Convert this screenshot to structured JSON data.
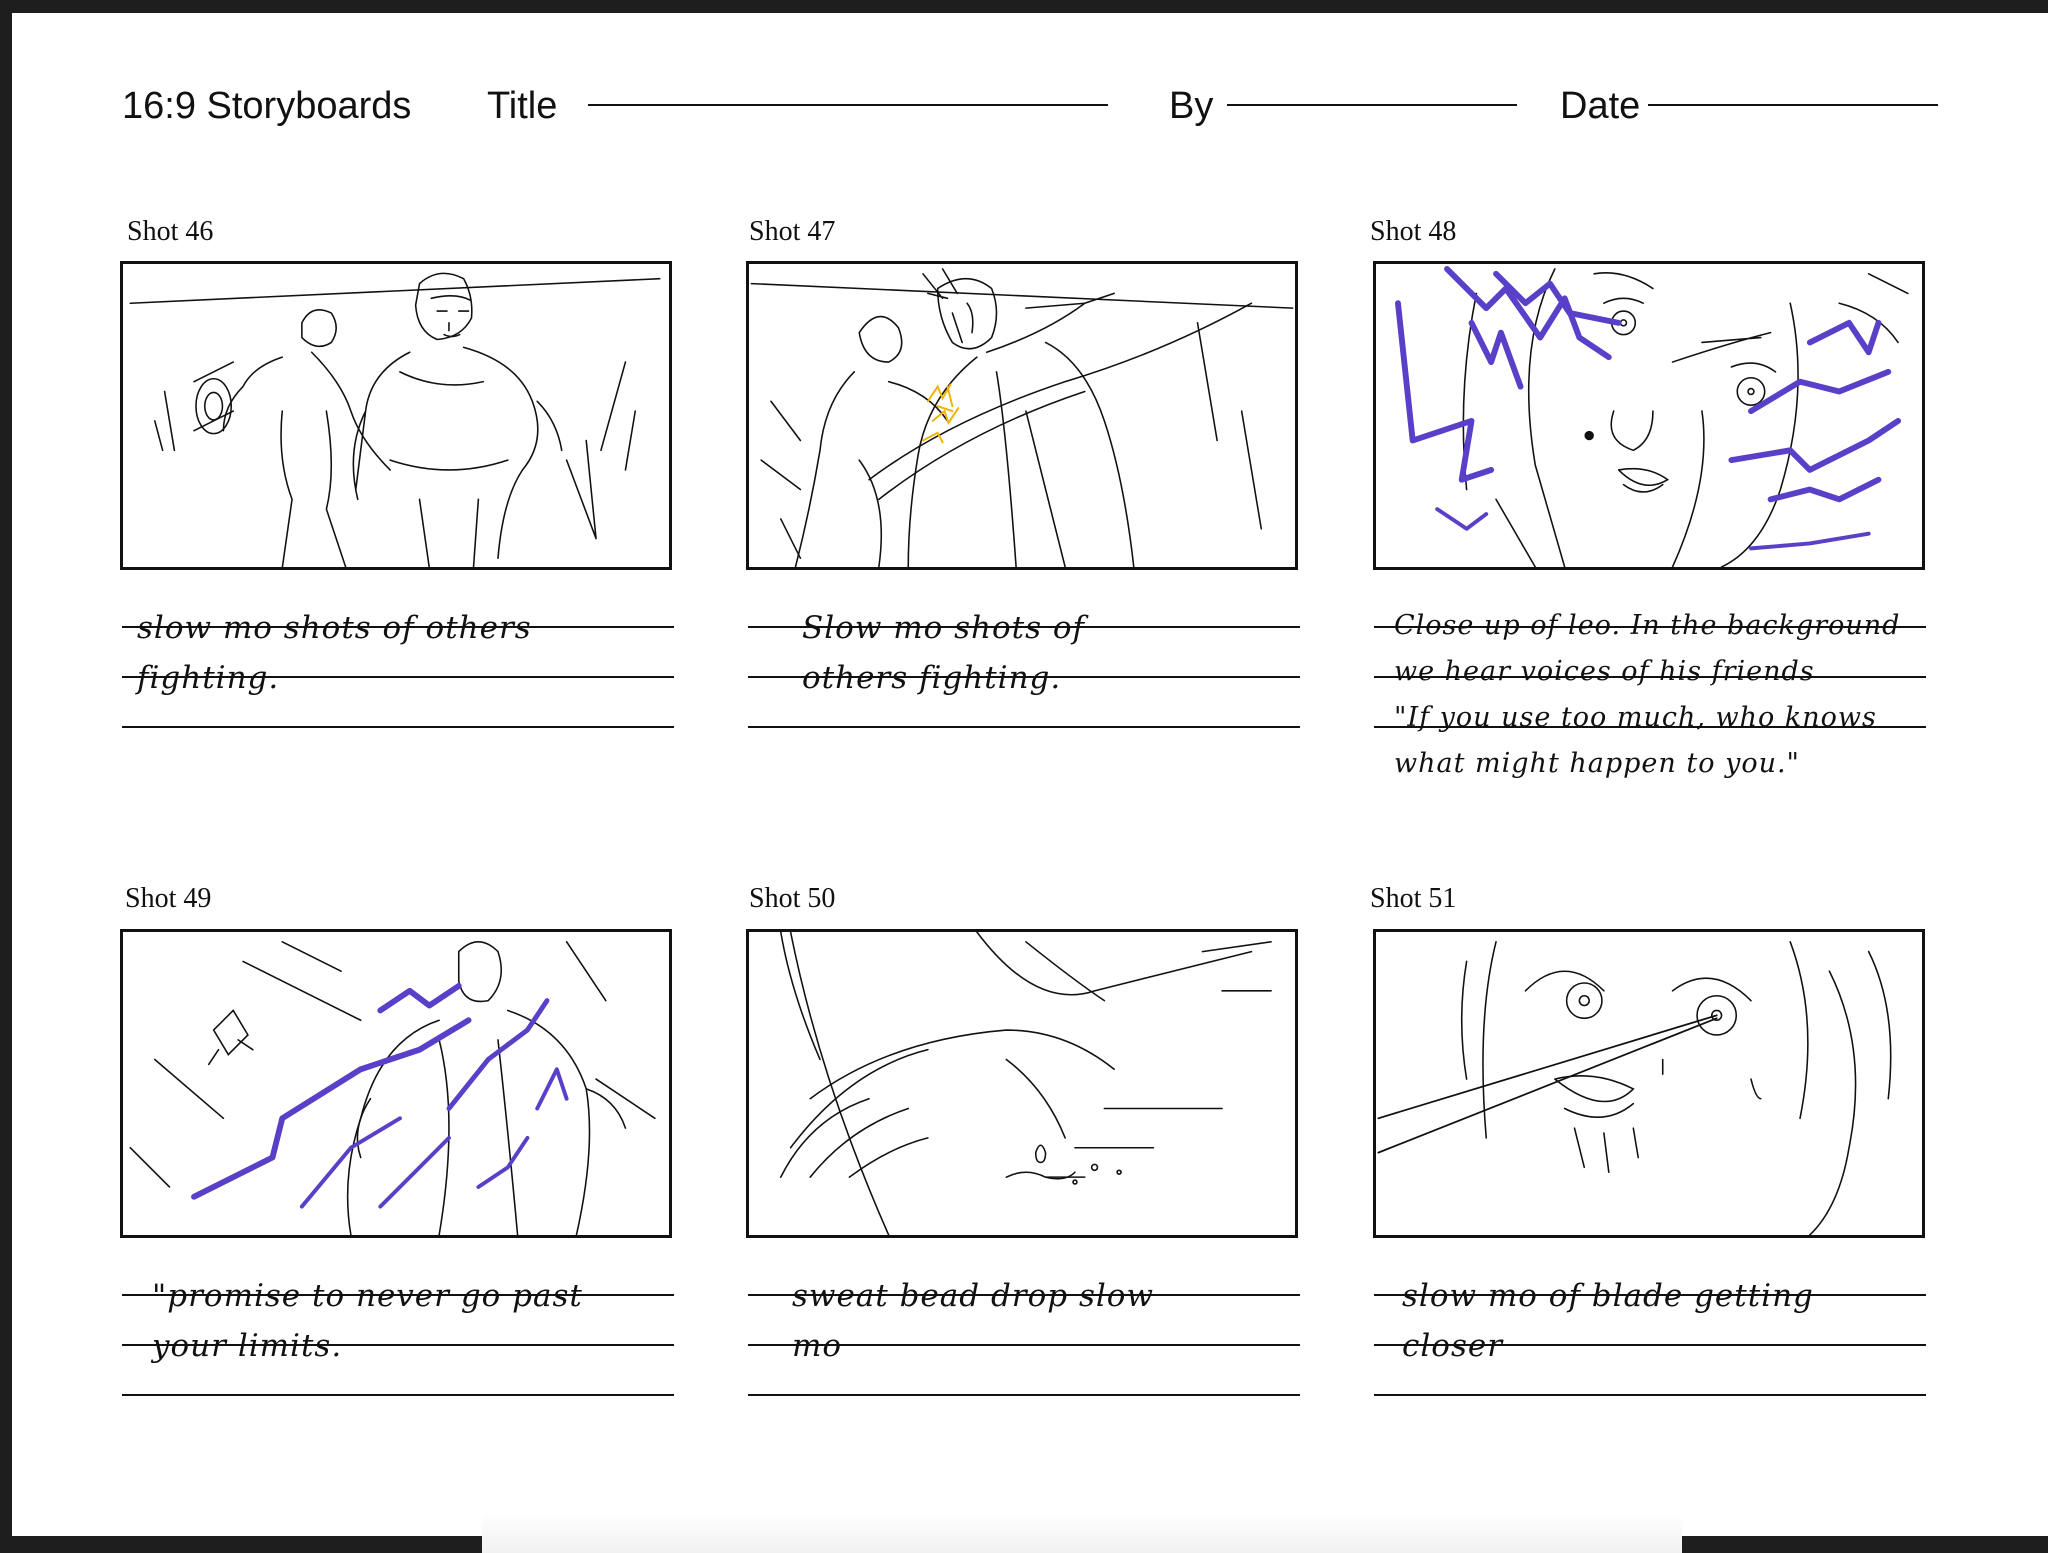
{
  "header": {
    "format": "16:9 Storyboards",
    "title_label": "Title",
    "by_label": "By",
    "date_label": "Date"
  },
  "colors": {
    "ink": "#111111",
    "accent_purple": "#5a3fc8",
    "accent_yellow": "#f2b400"
  },
  "shots": [
    {
      "label": "Shot 46",
      "note_lines": [
        "slow mo shots of others",
        "fighting."
      ]
    },
    {
      "label": "Shot 47",
      "note_lines": [
        "Slow mo shots of",
        "others fighting."
      ]
    },
    {
      "label": "Shot 48",
      "note_lines": [
        "Close up of leo. In the background",
        "we hear voices of his friends",
        "\"If you use too much, who knows",
        "what might happen to you.\""
      ]
    },
    {
      "label": "Shot 49",
      "note_lines": [
        "\"promise to never go past",
        "your limits."
      ]
    },
    {
      "label": "Shot 50",
      "note_lines": [
        "sweat bead drop slow",
        "mo"
      ]
    },
    {
      "label": "Shot 51",
      "note_lines": [
        "slow mo of blade getting",
        "closer"
      ]
    }
  ]
}
